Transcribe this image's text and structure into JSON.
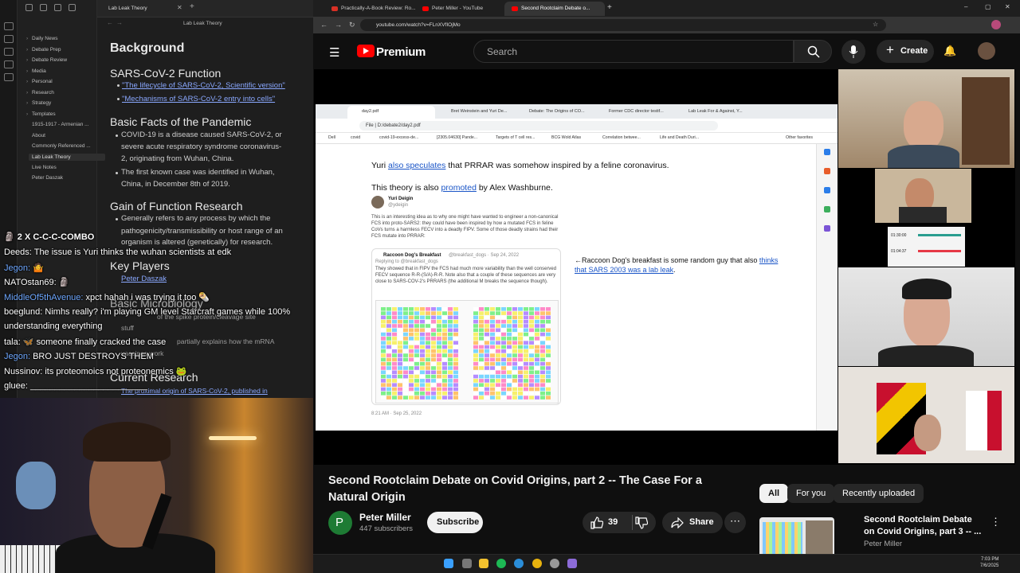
{
  "obsidian": {
    "tab_title": "Lab Leak Theory",
    "breadcrumb": "Lab Leak Theory",
    "files": [
      "Daily News",
      "Debate Prep",
      "Debate Review",
      "Media",
      "Personal",
      "Research",
      "Strategy",
      "Templates",
      "1915-1917 - Armenian ...",
      "About",
      "Commonly Referenced ...",
      "Lab Leak Theory",
      "Live Notes",
      "Peter Daszak"
    ],
    "note": {
      "h_background": "Background",
      "h_function": "SARS-CoV-2 Function",
      "link1": "\"The lifecycle of SARS-CoV-2, Scientific version\"",
      "link2": "\"Mechanisms of SARS-CoV-2 entry into cells\"",
      "h_facts": "Basic Facts of the Pandemic",
      "fact1a": "COVID-19 is a disease caused SARS-CoV-2, or",
      "fact1b": "severe acute respiratory syndrome coronavirus-",
      "fact1c": "2, originating from Wuhan, China.",
      "fact2a": "The first known case was identified in Wuhan,",
      "fact2b": "China, in December 8th of 2019.",
      "h_gof": "Gain of Function Research",
      "gof1": "Generally refers to any process by which the",
      "gof2": "pathogenicity/transmissibility or host range of an",
      "gof3": "organism is altered (genetically) for research.",
      "h_players": "Key Players",
      "player1": "Peter Daszak",
      "h_micro": "Basic Microbiology",
      "micro1": "of the spike protein/cleavage site",
      "micro2": "stuff",
      "micro3": "partially explains how the mRNA",
      "micro4": "vaccines work",
      "h_current": "Current Research",
      "current1": "The proximal origin of SARS-CoV-2, published in"
    }
  },
  "chat": {
    "combo": "2 X C-C-C-COMBO",
    "messages": [
      {
        "user": "Deeds:",
        "text": "The issue is Yuri thinks the wuhan scientists at edk"
      },
      {
        "user": "Jegon:",
        "text": "🤷"
      },
      {
        "user": "NATOstan69:",
        "text": "🗿"
      },
      {
        "user": "MiddleOf5thAvenue:",
        "text": "xpct hahah i was trying it too 🌯"
      },
      {
        "user": "boeglund:",
        "text": "Nimhs really? i'm playing GM level Starcraft games while 100%"
      },
      {
        "user": "",
        "text": "understanding everything"
      },
      {
        "user": "tala:",
        "text": "🦋 someone finally cracked the case"
      },
      {
        "user": "Jegon:",
        "text": "BRO JUST DESTROYS THEM"
      },
      {
        "user": "Nussinov:",
        "text": "its proteomoics not proteonemics 🐸"
      },
      {
        "user": "gluee:",
        "text": "________________________"
      }
    ]
  },
  "browser": {
    "tabs": [
      "Practically-A-Book Review: Ro...",
      "Peter Miller - YouTube",
      "Second Rootclaim Debate o..."
    ],
    "url": "youtube.com/watch?v=FLnXVfIOjMo"
  },
  "youtube": {
    "logo_text": "Premium",
    "search_placeholder": "Search",
    "create_label": "Create",
    "video_title": "Second Rootclaim Debate on Covid Origins, part 2 -- The Case For a Natural Origin",
    "channel_initial": "P",
    "channel_name": "Peter Miller",
    "subscribers": "447 subscribers",
    "subscribe_label": "Subscribe",
    "likes": "39",
    "share_label": "Share",
    "chips": [
      "All",
      "For you",
      "Recently uploaded"
    ],
    "rec_title": "Second Rootclaim Debate on Covid Origins, part 3 -- ...",
    "rec_channel": "Peter Miller"
  },
  "shared_screen": {
    "tabs": [
      "day2.pdf",
      "Bret Weinstein and Yuri De...",
      "Debate: The Origins of CO...",
      "Former CDC director testif...",
      "Lab Leak For & Against, Y..."
    ],
    "file_label": "File",
    "url": "D:/debate2/day2.pdf",
    "bookmarks": [
      "Dell",
      "covid",
      "covid-19-excess-de...",
      "[2305.04630] Pande...",
      "Targets of T cell res...",
      "BCG Wold Atlas",
      "Correlation betwee...",
      "Life and Death Duri...",
      "Other favorites"
    ],
    "line1_a": "Yuri ",
    "line1_link": "also speculates",
    "line1_b": " that PRRAR was somehow inspired by a feline coronavirus.",
    "line2_a": "This theory is also ",
    "line2_link": "promoted",
    "line2_b": " by Alex Washburne.",
    "tweet_author": "Yuri Deigin",
    "tweet_handle": "@ydeigin",
    "tweet_body": "This is an interesting idea as to why one might have wanted to engineer a non-canonical FCS into proto-SARS2: they could have been inspired by how a mutated FCS in feline CoVs turns a harmless FECV into a deadly FIPV. Some of those deadly strains had their FCS mutate into PRRAR:",
    "quote_author": "Raccoon Dog's Breakfast",
    "quote_handle": "@breakfast_dogs · Sep 24, 2022",
    "quote_reply": "Replying to @breakfast_dogs",
    "quote_body": "They showed that in FIPV the FCS had much more variability than the well conserved FECV sequence R-R-(S/A)-R-R. Note also that a couple of these sequences are very close to SARS-COV-2's PRRARS (the additional M breaks the sequence though).",
    "tweet_time": "8:21 AM · Sep 25, 2022",
    "note_a": "←Raccoon Dog's breakfast is some random guy that also",
    "note_link": "thinks that SARS 2003 was a lab leak",
    "note_b": "."
  },
  "taskbar": {
    "time": "7:03 PM",
    "date": "7/6/2025"
  }
}
